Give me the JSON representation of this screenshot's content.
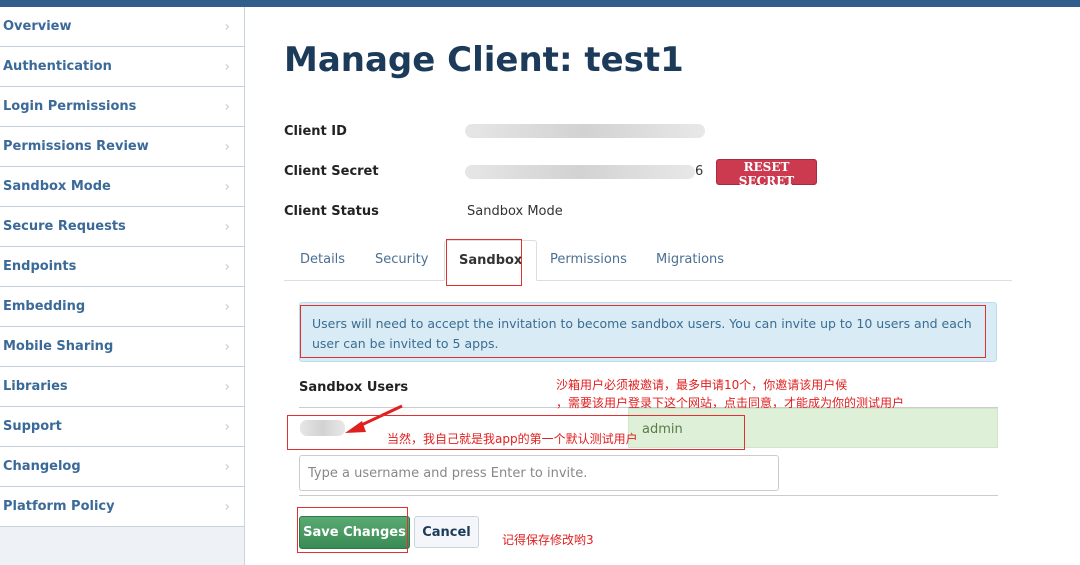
{
  "sidebar": {
    "items": [
      "Overview",
      "Authentication",
      "Login Permissions",
      "Permissions Review",
      "Sandbox Mode",
      "Secure Requests",
      "Endpoints",
      "Embedding",
      "Mobile Sharing",
      "Libraries",
      "Support",
      "Changelog",
      "Platform Policy"
    ]
  },
  "page": {
    "title": "Manage Client: test1"
  },
  "fields": {
    "client_id_label": "Client ID",
    "client_secret_label": "Client Secret",
    "client_secret_tail": "6",
    "client_status_label": "Client Status",
    "client_status_value": "Sandbox Mode",
    "reset_secret": "RESET SECRET"
  },
  "tabs": [
    "Details",
    "Security",
    "Sandbox",
    "Permissions",
    "Migrations"
  ],
  "sandbox": {
    "info": "Users will need to accept the invitation to become sandbox users. You can invite up to 10 users and each user can be invited to 5 apps.",
    "users_label": "Sandbox Users",
    "user_role": "admin",
    "invite_placeholder": "Type a username and press Enter to invite.",
    "save": "Save Changes",
    "cancel": "Cancel"
  },
  "annotations": {
    "note1a": "沙箱用户必须被邀请，最多申请10个，你邀请该用户候",
    "note1b": "，需要该用户登录下这个网站，点击同意，才能成为你的测试用户",
    "note2": "当然，我自己就是我app的第一个默认测试用户",
    "note3": "记得保存修改哟3"
  }
}
